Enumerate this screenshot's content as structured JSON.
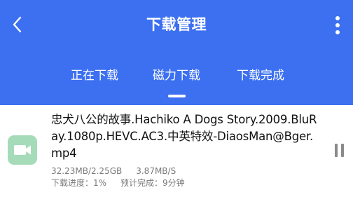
{
  "header": {
    "title": "下载管理",
    "bg_color": "#3c70f0",
    "back_icon": "chevron-left-icon",
    "more_icon": "more-vertical-icon"
  },
  "tabs": [
    {
      "label": "正在下载"
    },
    {
      "label": "磁力下载",
      "active": true
    },
    {
      "label": "下载完成"
    }
  ],
  "download": {
    "icon": "video-icon",
    "icon_color": "#a6dbb9",
    "file_name": "忠犬八公的故事.Hachiko A Dogs Story.2009.BluRay.1080p.HEVC.AC3.中英特效-DiaosMan@Bger.mp4",
    "size": "32.23MB/2.25GB",
    "speed": "3.87MB/S",
    "progress": "下载进度：1%",
    "eta": "预计完成：9分钟",
    "progress_value": 0.01,
    "action_icon": "pause-icon"
  }
}
